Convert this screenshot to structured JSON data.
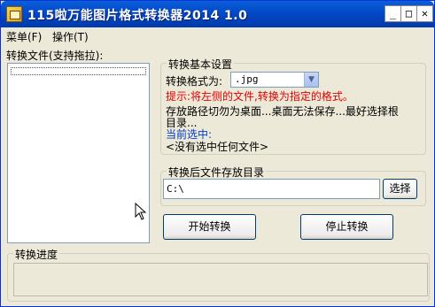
{
  "window": {
    "title": "115啦万能图片格式转换器2014 1.0",
    "buttons": {
      "minimize": "_",
      "maximize": "□",
      "close": "✕"
    }
  },
  "menubar": {
    "items": [
      {
        "label": "菜单(F)"
      },
      {
        "label": "操作(T)"
      }
    ]
  },
  "file_list": {
    "label": "转换文件(支持拖拉):"
  },
  "basic_settings": {
    "group_title": "转换基本设置",
    "format_label": "转换格式为:",
    "format_value": ".jpg",
    "tip": "提示:将左侧的文件,转换为指定的格式。",
    "save_note_line1": "存放路径切勿为桌面...桌面无法保存...最好选择根",
    "save_note_line2": "目录...",
    "current_label": "当前选中:",
    "current_value": "<没有选中任何文件>"
  },
  "output_dir": {
    "group_title": "转换后文件存放目录",
    "path_value": "C:\\",
    "browse_label": "选择"
  },
  "actions": {
    "start_label": "开始转换",
    "stop_label": "停止转换"
  },
  "progress": {
    "group_title": "转换进度"
  },
  "colors": {
    "titlebar": "#0248c7",
    "tip_red": "#e00000",
    "current_blue": "#003cc8",
    "window_bg": "#ece9d8"
  }
}
